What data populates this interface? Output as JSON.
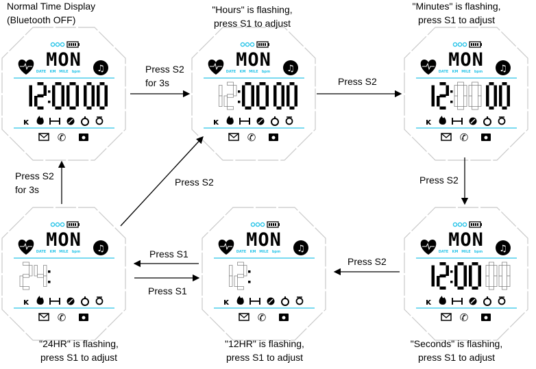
{
  "captions": {
    "normal_line1": "Normal Time Display",
    "normal_line2": "(Bluetooth OFF)",
    "hours_line1": "\"Hours\" is flashing,",
    "hours_line2": "press S1 to adjust",
    "minutes_line1": "\"Minutes\" is flashing,",
    "minutes_line2": "press S1 to adjust",
    "hr24_line1": "\"24HR\" is flashing,",
    "hr24_line2": "press S1 to adjust",
    "hr12_line1": "\"12HR\" is flashing,",
    "hr12_line2": "press S1 to adjust",
    "seconds_line1": "\"Seconds\" is flashing,",
    "seconds_line2": "press S1 to adjust"
  },
  "arrows": {
    "normal_to_hours_1": "Press S2",
    "normal_to_hours_2": "for 3s",
    "hours_to_minutes": "Press S2",
    "minutes_to_seconds": "Press S2",
    "seconds_to_12hr": "Press S2",
    "hr12_to_24hr": "Press S1",
    "hr24_to_12hr": "Press S1",
    "hr24_to_normal_1": "Press S2",
    "hr24_to_normal_2": "for 3s",
    "hr24_to_hours": "Press S2"
  },
  "watch": {
    "day": "MON",
    "indicators": [
      "DATE",
      "KM",
      "MILE",
      "bpm"
    ],
    "accent_color": "#29c4e8",
    "icons_row1": [
      "runner-icon",
      "flame-icon",
      "dumbbell-icon",
      "compass-icon",
      "stopwatch-icon",
      "alarm-icon"
    ],
    "icons_row2": [
      "envelope-icon",
      "phone-icon",
      "camera-icon"
    ]
  },
  "faces": [
    {
      "id": "normal",
      "digits": [
        "1",
        "2",
        "0",
        "0",
        "0",
        "0"
      ],
      "flashing": [
        false,
        false,
        false,
        false,
        false,
        false
      ]
    },
    {
      "id": "hours",
      "digits": [
        "1",
        "2",
        "0",
        "0",
        "0",
        "0"
      ],
      "flashing": [
        true,
        true,
        false,
        false,
        false,
        false
      ]
    },
    {
      "id": "minutes",
      "digits": [
        "1",
        "2",
        "0",
        "0",
        "0",
        "0"
      ],
      "flashing": [
        false,
        false,
        true,
        true,
        false,
        false
      ]
    },
    {
      "id": "hr24",
      "digits": [
        "2",
        "4",
        "",
        "",
        "",
        ""
      ],
      "flashing": [
        true,
        true,
        false,
        false,
        false,
        false
      ]
    },
    {
      "id": "hr12",
      "digits": [
        "1",
        "2",
        "",
        "",
        "",
        ""
      ],
      "flashing": [
        true,
        true,
        false,
        false,
        false,
        false
      ]
    },
    {
      "id": "seconds",
      "digits": [
        "1",
        "2",
        "0",
        "0",
        "0",
        "0"
      ],
      "flashing": [
        false,
        false,
        false,
        false,
        true,
        true
      ]
    }
  ]
}
